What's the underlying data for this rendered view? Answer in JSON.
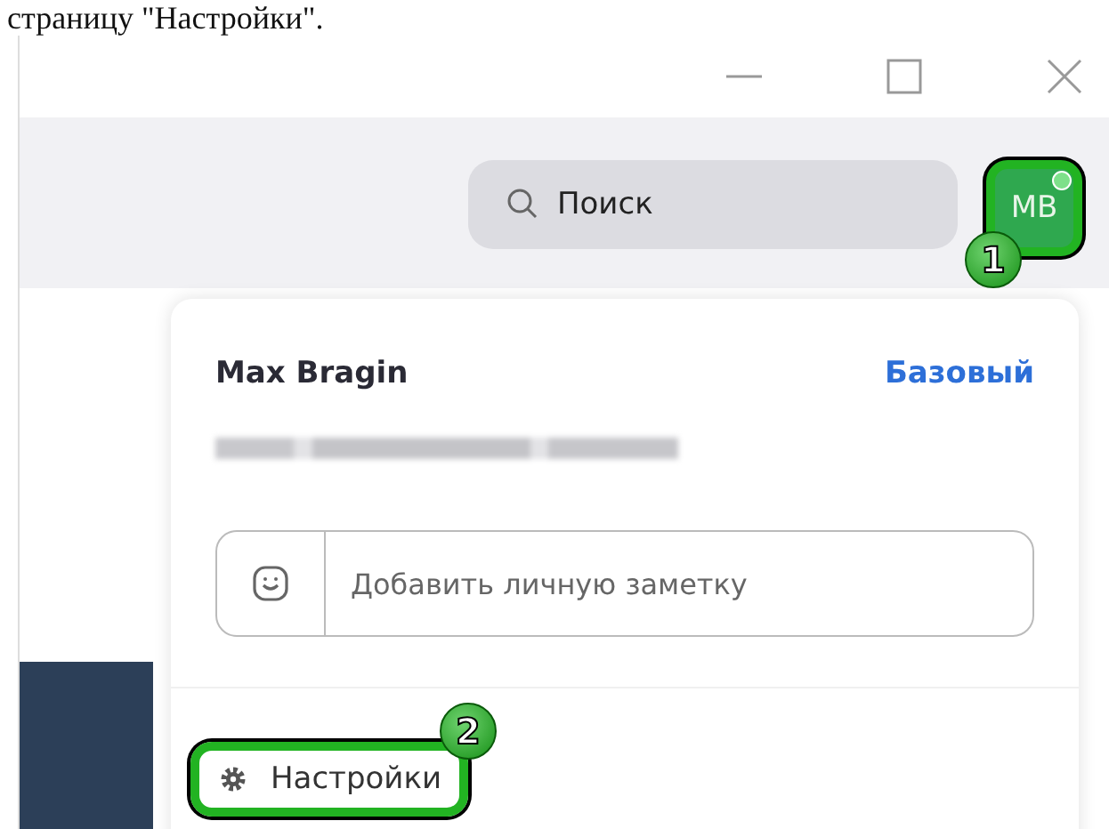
{
  "caption": "страницу \"Настройки\".",
  "search": {
    "placeholder": "Поиск"
  },
  "avatar": {
    "initials": "MB",
    "online": true,
    "step": "1"
  },
  "profile": {
    "name": "Max Bragin",
    "plan": "Базовый"
  },
  "note": {
    "placeholder": "Добавить личную заметку"
  },
  "menu": [
    {
      "label": "Настройки",
      "step": "2"
    }
  ]
}
